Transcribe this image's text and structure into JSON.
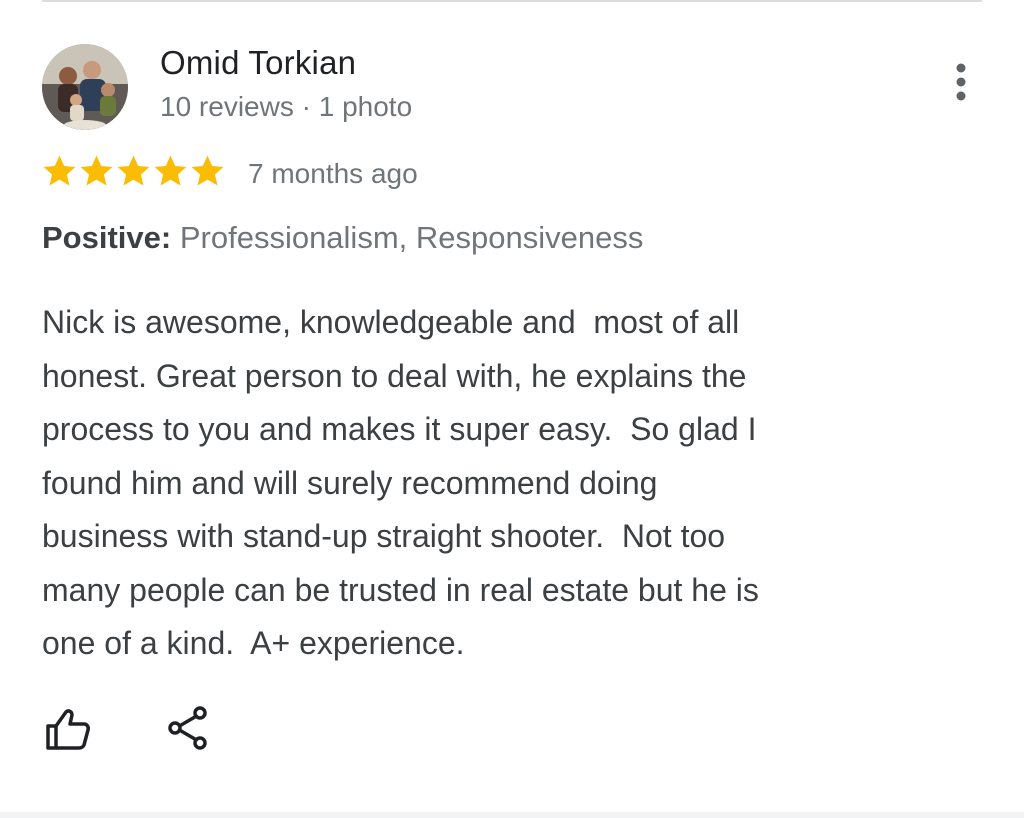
{
  "review": {
    "author": {
      "name": "Omid Torkian",
      "meta": "10 reviews · 1 photo",
      "avatar_icon": "user-photo-avatar"
    },
    "rating": 5,
    "rating_max": 5,
    "date": "7 months ago",
    "highlights": {
      "label": "Positive:",
      "value": "Professionalism, Responsiveness"
    },
    "text": "Nick is awesome, knowledgeable and  most of all\nhonest. Great person to deal with, he explains the\nprocess to you and makes it super easy.  So glad I\nfound him and will surely recommend doing\nbusiness with stand-up straight shooter.  Not too\nmany people can be trusted in real estate but he is\none of a kind.  A+ experience.",
    "actions": [
      {
        "icon": "thumbs-up-icon"
      },
      {
        "icon": "share-icon"
      }
    ],
    "menu_icon": "more-vert-icon"
  },
  "colors": {
    "star": "#fbbc04",
    "name": "#202124",
    "body_text": "#3c4043",
    "secondary_text": "#70757a",
    "divider": "#dcdcdc",
    "icon": "#202124"
  }
}
